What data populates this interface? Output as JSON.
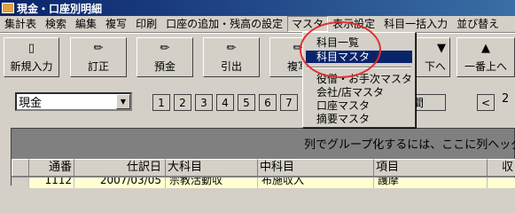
{
  "window": {
    "title": "現金・口座別明細",
    "icon": "ledger-window-icon"
  },
  "menubar": [
    "集計表",
    "検索",
    "編集",
    "複写",
    "印刷",
    "口座の追加・残高の設定",
    "マスタ",
    "表示設定",
    "科目一括入力",
    "並び替え"
  ],
  "active_menu": "マスタ",
  "dropdown": {
    "items": [
      "科目一覧",
      "科目マスタ",
      "役僧・お手次マスタ",
      "会社/店マスタ",
      "口座マスタ",
      "摘要マスタ"
    ],
    "selected": "科目マスタ"
  },
  "toolbar": [
    {
      "label": "新規入力",
      "icon": "new-document-icon"
    },
    {
      "label": "訂正",
      "icon": "pencil-icon"
    },
    {
      "label": "預金",
      "icon": "pencil-icon"
    },
    {
      "label": "引出",
      "icon": "pencil-icon"
    },
    {
      "label": "複写",
      "icon": "pencil-icon"
    },
    {
      "label": "下へ",
      "icon": "arrow-down-icon"
    },
    {
      "label": "一番上へ",
      "icon": "arrow-up-icon"
    }
  ],
  "account_select": {
    "value": "現金"
  },
  "pages": [
    "1",
    "2",
    "3",
    "4",
    "5",
    "6",
    "7"
  ],
  "period_button": "全期間",
  "nav": {
    "prev": "<",
    "next_page": "2"
  },
  "grid": {
    "group_hint": "列でグループ化するには、ここに列ヘッダ",
    "columns": [
      "通番",
      "仕訳日",
      "大科目",
      "中科目",
      "項目",
      "収"
    ],
    "row": [
      "1112",
      "2007/03/05",
      "宗教活動収",
      "布施収入",
      "護摩",
      ""
    ]
  },
  "colors": {
    "titlebar": "#0a246a",
    "selection": "#0a246a",
    "highlight_circle": "#e03030",
    "face": "#d4d0c8"
  }
}
